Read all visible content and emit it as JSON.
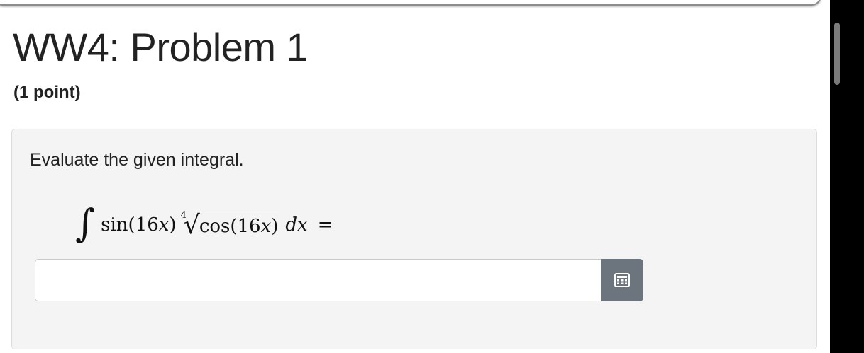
{
  "page": {
    "title": "WW4: Problem 1",
    "points": "(1 point)"
  },
  "problem": {
    "prompt": "Evaluate the given integral.",
    "math": {
      "integral": "∫",
      "factor1": "sin(16𝑥)",
      "root_index": "4",
      "radical": "√",
      "radicand": "cos(16𝑥)",
      "differential": "𝑑𝑥",
      "equals": "="
    },
    "answer": {
      "value": "",
      "placeholder": ""
    },
    "equation_editor_icon": "calculator-grid-icon"
  },
  "colors": {
    "panel_background": "#f4f4f4",
    "button_background": "#6c757d",
    "text": "#222222"
  }
}
